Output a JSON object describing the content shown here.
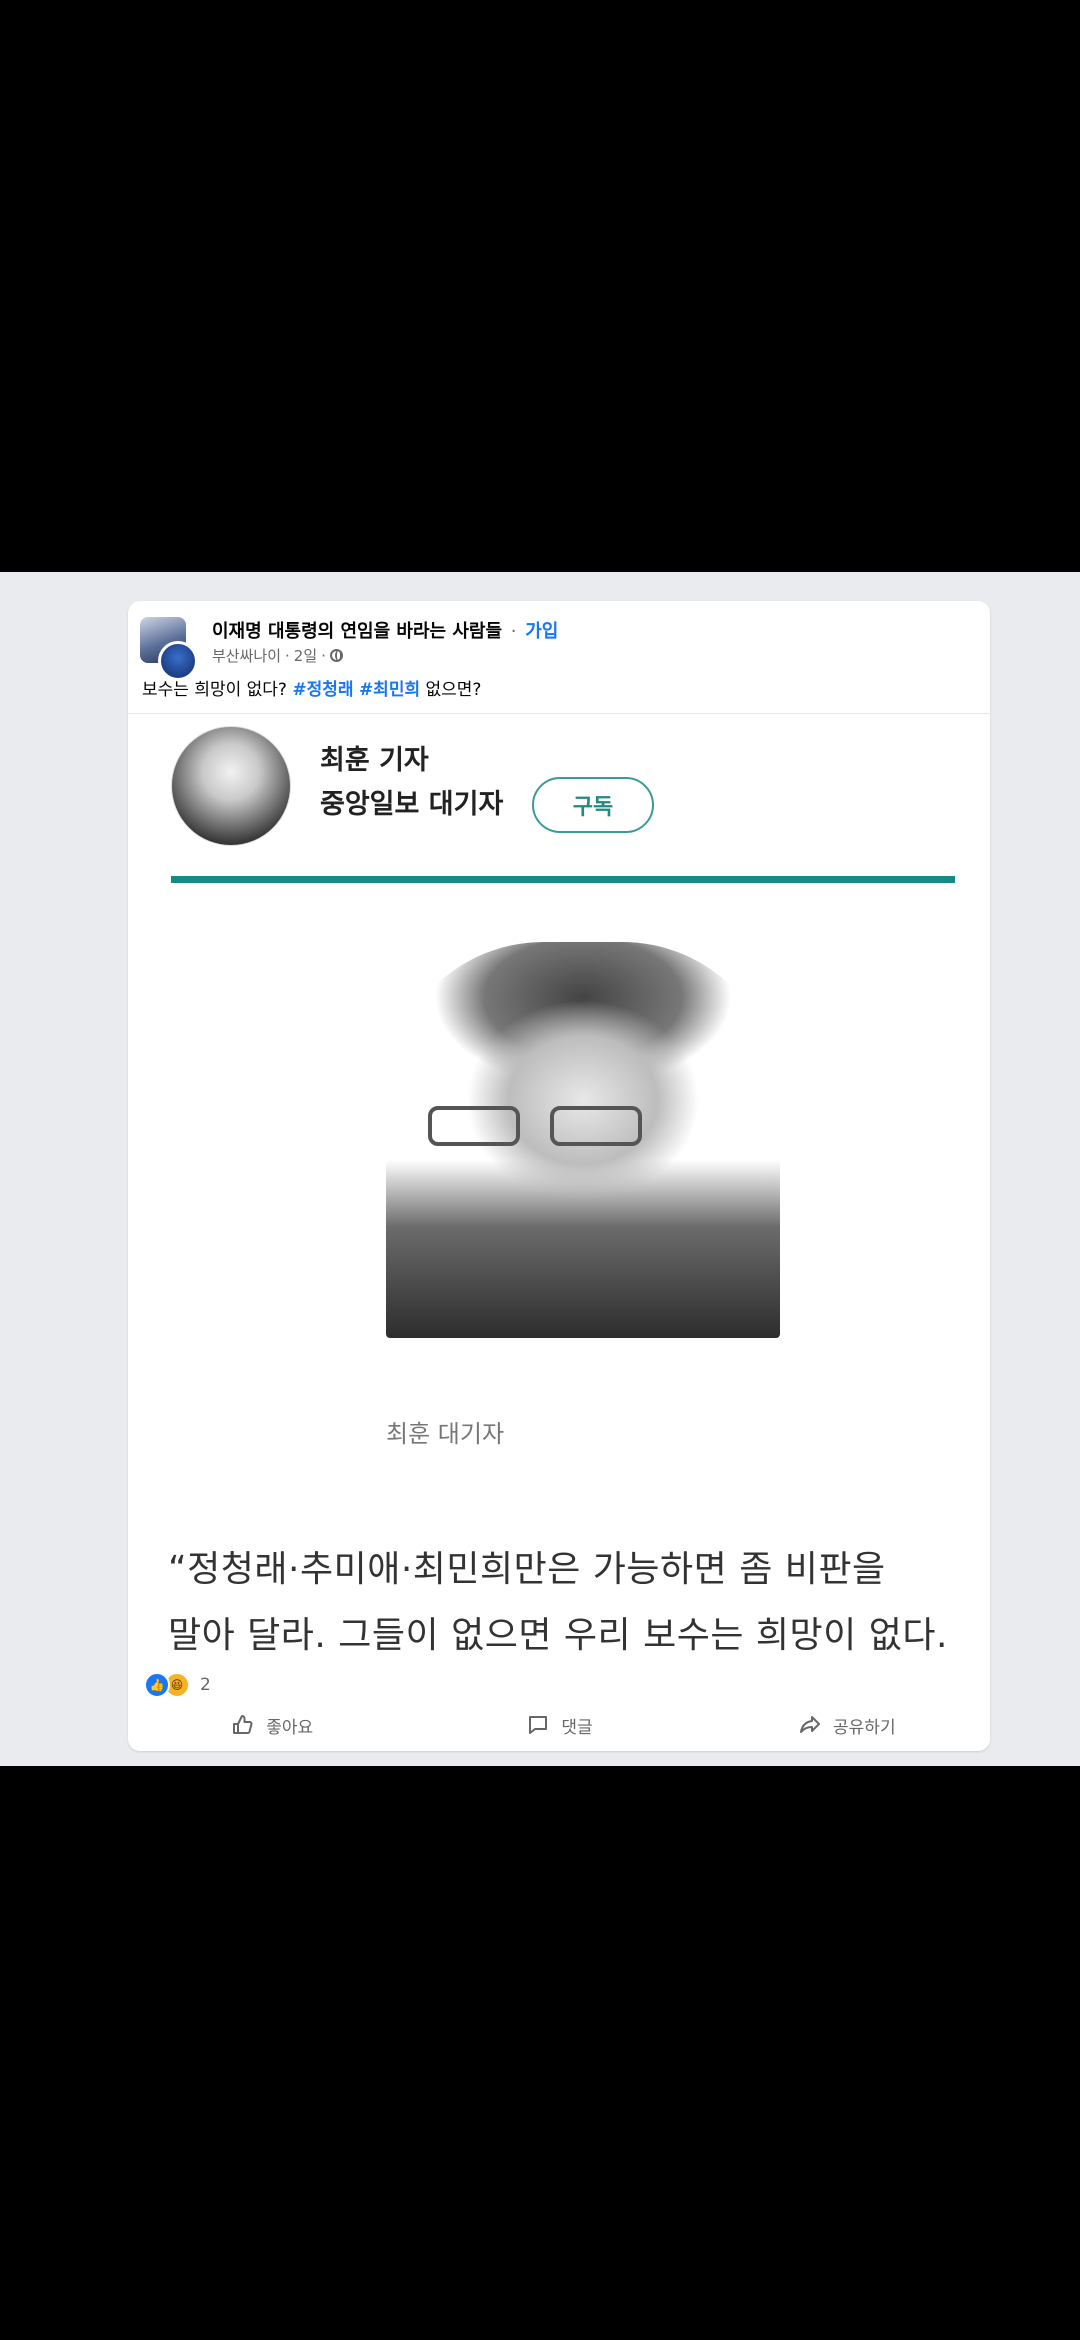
{
  "post": {
    "group_name": "이재명 대통령의 연임을 바라는 사람들",
    "separator": "·",
    "join_label": "가입",
    "author": "부산싸나이",
    "time": "2일",
    "text_prefix": "보수는 희망이 없다?",
    "hashtags": [
      "#정청래",
      "#최민희"
    ],
    "text_suffix": "없으면?"
  },
  "media": {
    "author_name": "최훈 기자",
    "author_title": "중앙일보 대기자",
    "subscribe_label": "구독",
    "caption": "최훈 대기자",
    "quote_line1": "“정청래·추미애·최민희만은 가능하면 좀 비판을",
    "quote_line2": "말아 달라. 그들이 없으면 우리 보수는 희망이 없다."
  },
  "reactions": {
    "count": "2",
    "icons": [
      "like-reaction",
      "haha-reaction"
    ]
  },
  "actions": {
    "like_label": "좋아요",
    "comment_label": "댓글",
    "share_label": "공유하기"
  },
  "colors": {
    "accent_blue": "#1877f2",
    "teal": "#158a85",
    "feed_bg": "#e9ebee"
  }
}
